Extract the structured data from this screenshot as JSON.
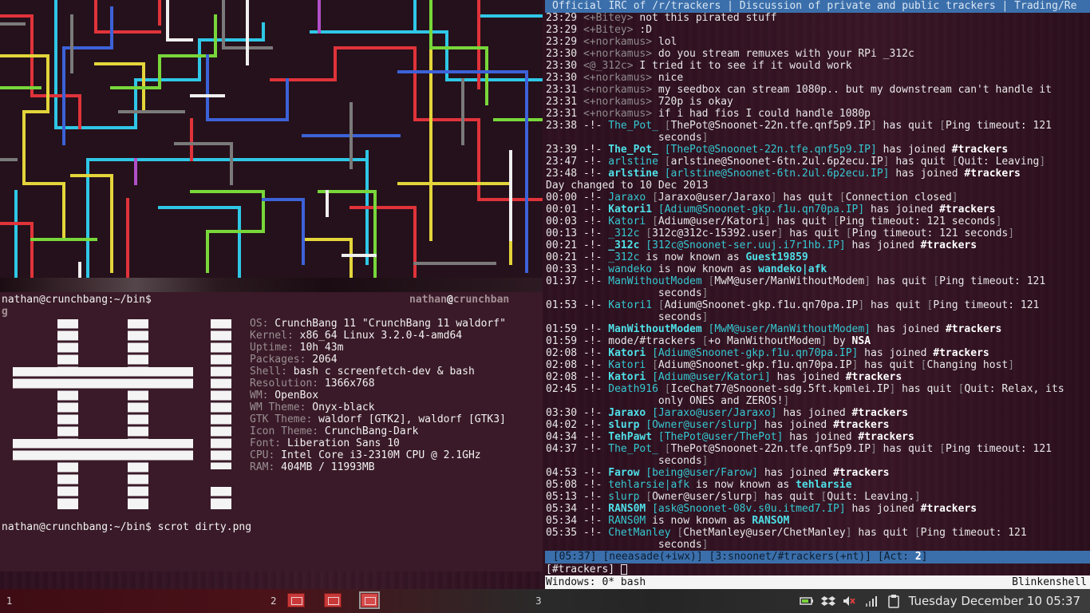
{
  "irc": {
    "topic": "Official IRC of /r/trackers | Discussion of private and public trackers | Trading/Re",
    "lines": [
      [
        [
          "23:29 ",
          "time"
        ],
        [
          "<+Bitey>",
          "grey"
        ],
        [
          " not this pirated stuff",
          "text"
        ]
      ],
      [
        [
          "23:29 ",
          "time"
        ],
        [
          "<+Bitey>",
          "grey"
        ],
        [
          " :D",
          "text"
        ]
      ],
      [
        [
          "23:29 ",
          "time"
        ],
        [
          "<+norkamus>",
          "grey"
        ],
        [
          " lol",
          "text"
        ]
      ],
      [
        [
          "23:30 ",
          "time"
        ],
        [
          "<+norkamus>",
          "grey"
        ],
        [
          " do you stream remuxes with your RPi _312c",
          "text"
        ]
      ],
      [
        [
          "23:30 ",
          "time"
        ],
        [
          "<@_312c>",
          "grey"
        ],
        [
          " I tried it to see if it would work",
          "text"
        ]
      ],
      [
        [
          "23:30 ",
          "time"
        ],
        [
          "<+norkamus>",
          "grey"
        ],
        [
          " nice",
          "text"
        ]
      ],
      [
        [
          "23:31 ",
          "time"
        ],
        [
          "<+norkamus>",
          "grey"
        ],
        [
          " my seedbox can stream 1080p.. but my downstream can't handle it",
          "text"
        ]
      ],
      [
        [
          "23:31 ",
          "time"
        ],
        [
          "<+norkamus>",
          "grey"
        ],
        [
          " 720p is okay",
          "text"
        ]
      ],
      [
        [
          "23:31 ",
          "time"
        ],
        [
          "<+norkamus>",
          "grey"
        ],
        [
          " if i had fios I could handle 1080p",
          "text"
        ]
      ],
      [
        [
          "23:38 ",
          "time"
        ],
        [
          "-!- ",
          "text"
        ],
        [
          "The_Pot_",
          "cyan"
        ],
        [
          " [",
          "grey"
        ],
        [
          "ThePot@Snoonet-22n.tfe.qnf5p9.IP",
          "text"
        ],
        [
          "]",
          "grey"
        ],
        [
          " has quit ",
          "text"
        ],
        [
          "[",
          "grey"
        ],
        [
          "Ping timeout: 121",
          "text"
        ]
      ],
      [
        [
          "                  seconds",
          "text"
        ],
        [
          "]",
          "grey"
        ]
      ],
      [
        [
          "23:39 ",
          "time"
        ],
        [
          "-!- ",
          "text"
        ],
        [
          "The_Pot_",
          "cyanb"
        ],
        [
          " [ThePot@Snoonet-22n.tfe.qnf5p9.IP]",
          "cyan"
        ],
        [
          " has joined ",
          "text"
        ],
        [
          "#trackers",
          "bold"
        ]
      ],
      [
        [
          "23:47 ",
          "time"
        ],
        [
          "-!- ",
          "text"
        ],
        [
          "arlstine",
          "cyan"
        ],
        [
          " [",
          "grey"
        ],
        [
          "arlstine@Snoonet-6tn.2ul.6p2ecu.IP",
          "text"
        ],
        [
          "]",
          "grey"
        ],
        [
          " has quit ",
          "text"
        ],
        [
          "[",
          "grey"
        ],
        [
          "Quit: Leaving",
          "text"
        ],
        [
          "]",
          "grey"
        ]
      ],
      [
        [
          "23:48 ",
          "time"
        ],
        [
          "-!- ",
          "text"
        ],
        [
          "arlstine",
          "cyanb"
        ],
        [
          " [arlstine@Snoonet-6tn.2ul.6p2ecu.IP]",
          "cyan"
        ],
        [
          " has joined ",
          "text"
        ],
        [
          "#trackers",
          "bold"
        ]
      ],
      [
        [
          "Day changed to 10 Dec 2013",
          "text"
        ]
      ],
      [
        [
          "00:00 ",
          "time"
        ],
        [
          "-!- ",
          "text"
        ],
        [
          "Jaraxo",
          "cyan"
        ],
        [
          " [",
          "grey"
        ],
        [
          "Jaraxo@user/Jaraxo",
          "text"
        ],
        [
          "]",
          "grey"
        ],
        [
          " has quit ",
          "text"
        ],
        [
          "[",
          "grey"
        ],
        [
          "Connection closed",
          "text"
        ],
        [
          "]",
          "grey"
        ]
      ],
      [
        [
          "00:01 ",
          "time"
        ],
        [
          "-!- ",
          "text"
        ],
        [
          "Katori1",
          "cyanb"
        ],
        [
          " [Adium@Snoonet-gkp.f1u.qn70pa.IP]",
          "cyan"
        ],
        [
          " has joined ",
          "text"
        ],
        [
          "#trackers",
          "bold"
        ]
      ],
      [
        [
          "00:03 ",
          "time"
        ],
        [
          "-!- ",
          "text"
        ],
        [
          "Katori",
          "cyan"
        ],
        [
          " [",
          "grey"
        ],
        [
          "Adium@user/Katori",
          "text"
        ],
        [
          "]",
          "grey"
        ],
        [
          " has quit ",
          "text"
        ],
        [
          "[",
          "grey"
        ],
        [
          "Ping timeout: 121 seconds",
          "text"
        ],
        [
          "]",
          "grey"
        ]
      ],
      [
        [
          "00:13 ",
          "time"
        ],
        [
          "-!- ",
          "text"
        ],
        [
          "_312c",
          "cyan"
        ],
        [
          " [",
          "grey"
        ],
        [
          "312c@312c-15392.user",
          "text"
        ],
        [
          "]",
          "grey"
        ],
        [
          " has quit ",
          "text"
        ],
        [
          "[",
          "grey"
        ],
        [
          "Ping timeout: 121 seconds",
          "text"
        ],
        [
          "]",
          "grey"
        ]
      ],
      [
        [
          "00:21 ",
          "time"
        ],
        [
          "-!- ",
          "text"
        ],
        [
          "_312c",
          "cyanb"
        ],
        [
          " [312c@Snoonet-ser.uuj.i7r1hb.IP]",
          "cyan"
        ],
        [
          " has joined ",
          "text"
        ],
        [
          "#trackers",
          "bold"
        ]
      ],
      [
        [
          "00:21 ",
          "time"
        ],
        [
          "-!- ",
          "text"
        ],
        [
          "_312c",
          "cyan"
        ],
        [
          " is now known as ",
          "text"
        ],
        [
          "Guest19859",
          "cyanb"
        ]
      ],
      [
        [
          "00:33 ",
          "time"
        ],
        [
          "-!- ",
          "text"
        ],
        [
          "wandeko",
          "cyan"
        ],
        [
          " is now known as ",
          "text"
        ],
        [
          "wandeko|afk",
          "cyanb"
        ]
      ],
      [
        [
          "01:37 ",
          "time"
        ],
        [
          "-!- ",
          "text"
        ],
        [
          "ManWithoutModem",
          "cyan"
        ],
        [
          " [",
          "grey"
        ],
        [
          "MwM@user/ManWithoutModem",
          "text"
        ],
        [
          "]",
          "grey"
        ],
        [
          " has quit ",
          "text"
        ],
        [
          "[",
          "grey"
        ],
        [
          "Ping timeout: 121",
          "text"
        ]
      ],
      [
        [
          "                  seconds",
          "text"
        ],
        [
          "]",
          "grey"
        ]
      ],
      [
        [
          "01:53 ",
          "time"
        ],
        [
          "-!- ",
          "text"
        ],
        [
          "Katori1",
          "cyan"
        ],
        [
          " [",
          "grey"
        ],
        [
          "Adium@Snoonet-gkp.f1u.qn70pa.IP",
          "text"
        ],
        [
          "]",
          "grey"
        ],
        [
          " has quit ",
          "text"
        ],
        [
          "[",
          "grey"
        ],
        [
          "Ping timeout: 121",
          "text"
        ]
      ],
      [
        [
          "                  seconds",
          "text"
        ],
        [
          "]",
          "grey"
        ]
      ],
      [
        [
          "01:59 ",
          "time"
        ],
        [
          "-!- ",
          "text"
        ],
        [
          "ManWithoutModem",
          "cyanb"
        ],
        [
          " [MwM@user/ManWithoutModem]",
          "cyan"
        ],
        [
          " has joined ",
          "text"
        ],
        [
          "#trackers",
          "bold"
        ]
      ],
      [
        [
          "01:59 ",
          "time"
        ],
        [
          "-!- ",
          "text"
        ],
        [
          "mode/#trackers ",
          "text"
        ],
        [
          "[",
          "grey"
        ],
        [
          "+o ManWithoutModem",
          "text"
        ],
        [
          "]",
          "grey"
        ],
        [
          " by ",
          "text"
        ],
        [
          "NSA",
          "bold"
        ]
      ],
      [
        [
          "02:08 ",
          "time"
        ],
        [
          "-!- ",
          "text"
        ],
        [
          "Katori",
          "cyanb"
        ],
        [
          " [Adium@Snoonet-gkp.f1u.qn70pa.IP]",
          "cyan"
        ],
        [
          " has joined ",
          "text"
        ],
        [
          "#trackers",
          "bold"
        ]
      ],
      [
        [
          "02:08 ",
          "time"
        ],
        [
          "-!- ",
          "text"
        ],
        [
          "Katori",
          "cyan"
        ],
        [
          " [",
          "grey"
        ],
        [
          "Adium@Snoonet-gkp.f1u.qn70pa.IP",
          "text"
        ],
        [
          "]",
          "grey"
        ],
        [
          " has quit ",
          "text"
        ],
        [
          "[",
          "grey"
        ],
        [
          "Changing host",
          "text"
        ],
        [
          "]",
          "grey"
        ]
      ],
      [
        [
          "02:08 ",
          "time"
        ],
        [
          "-!- ",
          "text"
        ],
        [
          "Katori",
          "cyanb"
        ],
        [
          " [Adium@user/Katori]",
          "cyan"
        ],
        [
          " has joined ",
          "text"
        ],
        [
          "#trackers",
          "bold"
        ]
      ],
      [
        [
          "02:45 ",
          "time"
        ],
        [
          "-!- ",
          "text"
        ],
        [
          "Death916",
          "cyan"
        ],
        [
          " [",
          "grey"
        ],
        [
          "IceChat77@Snoonet-sdg.5ft.kpmlei.IP",
          "text"
        ],
        [
          "]",
          "grey"
        ],
        [
          " has quit ",
          "text"
        ],
        [
          "[",
          "grey"
        ],
        [
          "Quit: Relax, its",
          "text"
        ]
      ],
      [
        [
          "                  only ONES and ZEROS!",
          "text"
        ],
        [
          "]",
          "grey"
        ]
      ],
      [
        [
          "03:30 ",
          "time"
        ],
        [
          "-!- ",
          "text"
        ],
        [
          "Jaraxo",
          "cyanb"
        ],
        [
          " [Jaraxo@user/Jaraxo]",
          "cyan"
        ],
        [
          " has joined ",
          "text"
        ],
        [
          "#trackers",
          "bold"
        ]
      ],
      [
        [
          "04:02 ",
          "time"
        ],
        [
          "-!- ",
          "text"
        ],
        [
          "slurp",
          "cyanb"
        ],
        [
          " [Owner@user/slurp]",
          "cyan"
        ],
        [
          " has joined ",
          "text"
        ],
        [
          "#trackers",
          "bold"
        ]
      ],
      [
        [
          "04:34 ",
          "time"
        ],
        [
          "-!- ",
          "text"
        ],
        [
          "TehPawt",
          "cyanb"
        ],
        [
          " [ThePot@user/ThePot]",
          "cyan"
        ],
        [
          " has joined ",
          "text"
        ],
        [
          "#trackers",
          "bold"
        ]
      ],
      [
        [
          "04:37 ",
          "time"
        ],
        [
          "-!- ",
          "text"
        ],
        [
          "The_Pot_",
          "cyan"
        ],
        [
          " [",
          "grey"
        ],
        [
          "ThePot@Snoonet-22n.tfe.qnf5p9.IP",
          "text"
        ],
        [
          "]",
          "grey"
        ],
        [
          " has quit ",
          "text"
        ],
        [
          "[",
          "grey"
        ],
        [
          "Ping timeout: 121",
          "text"
        ]
      ],
      [
        [
          "                  seconds",
          "text"
        ],
        [
          "]",
          "grey"
        ]
      ],
      [
        [
          "04:53 ",
          "time"
        ],
        [
          "-!- ",
          "text"
        ],
        [
          "Farow",
          "cyanb"
        ],
        [
          " [being@user/Farow]",
          "cyan"
        ],
        [
          " has joined ",
          "text"
        ],
        [
          "#trackers",
          "bold"
        ]
      ],
      [
        [
          "05:08 ",
          "time"
        ],
        [
          "-!- ",
          "text"
        ],
        [
          "tehlarsie|afk",
          "cyan"
        ],
        [
          " is now known as ",
          "text"
        ],
        [
          "tehlarsie",
          "cyanb"
        ]
      ],
      [
        [
          "05:13 ",
          "time"
        ],
        [
          "-!- ",
          "text"
        ],
        [
          "slurp",
          "cyan"
        ],
        [
          " [",
          "grey"
        ],
        [
          "Owner@user/slurp",
          "text"
        ],
        [
          "]",
          "grey"
        ],
        [
          " has quit ",
          "text"
        ],
        [
          "[",
          "grey"
        ],
        [
          "Quit: Leaving.",
          "text"
        ],
        [
          "]",
          "grey"
        ]
      ],
      [
        [
          "05:34 ",
          "time"
        ],
        [
          "-!- ",
          "text"
        ],
        [
          "RANS0M",
          "cyanb"
        ],
        [
          " [ask@Snoonet-08v.s0u.itmed7.IP]",
          "cyan"
        ],
        [
          " has joined ",
          "text"
        ],
        [
          "#trackers",
          "bold"
        ]
      ],
      [
        [
          "05:34 ",
          "time"
        ],
        [
          "-!- ",
          "text"
        ],
        [
          "RANS0M",
          "cyan"
        ],
        [
          " is now known as ",
          "text"
        ],
        [
          "RANSOM",
          "cyanb"
        ]
      ],
      [
        [
          "05:35 ",
          "time"
        ],
        [
          "-!- ",
          "text"
        ],
        [
          "ChetManley",
          "cyan"
        ],
        [
          " [",
          "grey"
        ],
        [
          "ChetManley@user/ChetManley",
          "text"
        ],
        [
          "]",
          "grey"
        ],
        [
          " has quit ",
          "text"
        ],
        [
          "[",
          "grey"
        ],
        [
          "Ping timeout: 121",
          "text"
        ]
      ],
      [
        [
          "                  seconds",
          "text"
        ],
        [
          "]",
          "grey"
        ]
      ]
    ],
    "status": {
      "time": " [05:37]",
      "nick": " [neeasade(+iwx)]",
      "window": " [3:snoonet/#trackers(+nt)]",
      "act_label": " [Act: ",
      "act_value": "2",
      "act_close": "]"
    },
    "input": "[#trackers] ",
    "windows_bar": "Windows: 0* bash",
    "windows_right": "Blinkenshell"
  },
  "terminal": {
    "prompt1": "nathan@crunchbang:~/bin$",
    "prompt_right_user": "nathan",
    "prompt_right_at": "@",
    "prompt_right_host": "crunchban",
    "prompt_wrap": "g",
    "command_prompt": "nathan@crunchbang:~/bin$ scrot dirty.png",
    "info": [
      {
        "key": "OS:",
        "value": " CrunchBang 11 \"CrunchBang 11 waldorf\""
      },
      {
        "key": "Kernel:",
        "value": " x86_64 Linux 3.2.0-4-amd64"
      },
      {
        "key": "Uptime:",
        "value": " 10h 43m"
      },
      {
        "key": "Packages:",
        "value": " 2064"
      },
      {
        "key": "Shell:",
        "value": " bash c screenfetch-dev & bash"
      },
      {
        "key": "Resolution:",
        "value": " 1366x768"
      },
      {
        "key": "WM:",
        "value": " OpenBox"
      },
      {
        "key": "WM Theme:",
        "value": " Onyx-black"
      },
      {
        "key": "GTK Theme:",
        "value": " waldorf [GTK2], waldorf [GTK3]"
      },
      {
        "key": "Icon Theme:",
        "value": " CrunchBang-Dark"
      },
      {
        "key": "Font:",
        "value": " Liberation Sans 10"
      },
      {
        "key": "CPU:",
        "value": " Intel Core i3-2310M CPU @ 2.1GHz"
      },
      {
        "key": "RAM:",
        "value": " 404MB / 11993MB"
      }
    ]
  },
  "taskbar": {
    "workspaces": [
      "1",
      "2",
      "3"
    ],
    "tasks": [
      {
        "name": "terminal-window-1",
        "active": false
      },
      {
        "name": "terminal-window-2",
        "active": false
      },
      {
        "name": "terminal-window-3",
        "active": true
      }
    ],
    "tray_icons": [
      "battery-icon",
      "dropbox-icon",
      "volume-muted-icon",
      "network-signal-icon",
      "clipboard-icon"
    ],
    "clock": "Tuesday December 10 05:37"
  },
  "colors": {
    "irc_bar": "#3b6fab",
    "nick_cyan": "#35c9d2",
    "background": "#2e1020"
  }
}
